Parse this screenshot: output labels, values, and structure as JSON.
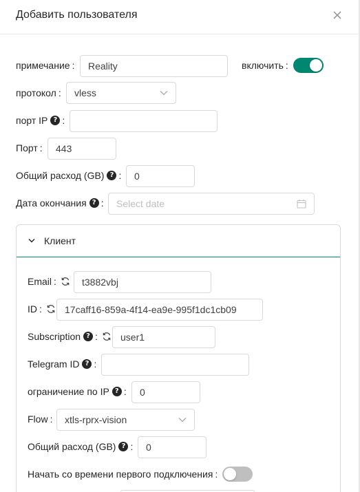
{
  "dialog": {
    "title": "Добавить пользователя"
  },
  "form": {
    "note": {
      "label": "примечание",
      "value": "Reality"
    },
    "enable": {
      "label": "включить",
      "on": true
    },
    "protocol": {
      "label": "протокол",
      "value": "vless"
    },
    "port_ip": {
      "label": "порт IP",
      "value": ""
    },
    "port": {
      "label": "Порт",
      "value": "443"
    },
    "total_traffic": {
      "label": "Общий расход (GB)",
      "value": "0"
    },
    "expiry": {
      "label": "Дата окончания",
      "placeholder": "Select date"
    }
  },
  "client": {
    "title": "Клиент",
    "email": {
      "label": "Email",
      "value": "t3882vbj"
    },
    "id": {
      "label": "ID",
      "value": "17caff16-859a-4f14-ea9e-995f1dc1cb09"
    },
    "subscription": {
      "label": "Subscription",
      "value": "user1"
    },
    "telegram_id": {
      "label": "Telegram ID",
      "value": ""
    },
    "ip_limit": {
      "label": "ограничение по IP",
      "value": "0"
    },
    "flow": {
      "label": "Flow",
      "value": "xtls-rprx-vision"
    },
    "total_traffic": {
      "label": "Общий расход (GB)",
      "value": "0"
    },
    "start_after_first_use": {
      "label": "Начать со времени первого подключения",
      "on": false
    }
  },
  "colors": {
    "accent": "#008771",
    "toggle_off": "#bfbfbf",
    "border": "#d9d9d9",
    "text": "#262626"
  },
  "icons": {
    "close": "close-icon",
    "help": "question-circle-icon",
    "sync": "sync-icon",
    "chevron": "chevron-down-icon",
    "calendar": "calendar-icon"
  }
}
